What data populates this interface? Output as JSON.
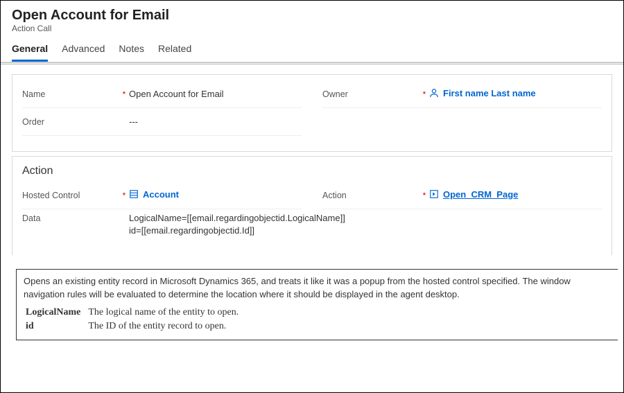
{
  "header": {
    "title": "Open Account for Email",
    "subtitle": "Action Call"
  },
  "tabs": [
    {
      "label": "General",
      "active": true
    },
    {
      "label": "Advanced",
      "active": false
    },
    {
      "label": "Notes",
      "active": false
    },
    {
      "label": "Related",
      "active": false
    }
  ],
  "topForm": {
    "name": {
      "label": "Name",
      "required": true,
      "value": "Open Account for Email"
    },
    "owner": {
      "label": "Owner",
      "required": true,
      "display": "First name Last name"
    },
    "order": {
      "label": "Order",
      "required": false,
      "value": "---"
    }
  },
  "actionSection": {
    "title": "Action",
    "hostedControl": {
      "label": "Hosted Control",
      "required": true,
      "display": "Account"
    },
    "action": {
      "label": "Action",
      "required": true,
      "display": "Open_CRM_Page"
    },
    "data": {
      "label": "Data",
      "required": false,
      "value": "LogicalName=[[email.regardingobjectid.LogicalName]]\nid=[[email.regardingobjectid.Id]]"
    }
  },
  "description": {
    "text": "Opens an existing entity record in Microsoft Dynamics 365, and treats it like it was a popup from the hosted control specified.   The window navigation rules will be evaluated to determine the location where it should be displayed in the agent desktop.",
    "params": [
      {
        "name": "LogicalName",
        "desc": "The logical name of the entity to open."
      },
      {
        "name": "id",
        "desc": "The ID of the entity record to open."
      }
    ]
  }
}
